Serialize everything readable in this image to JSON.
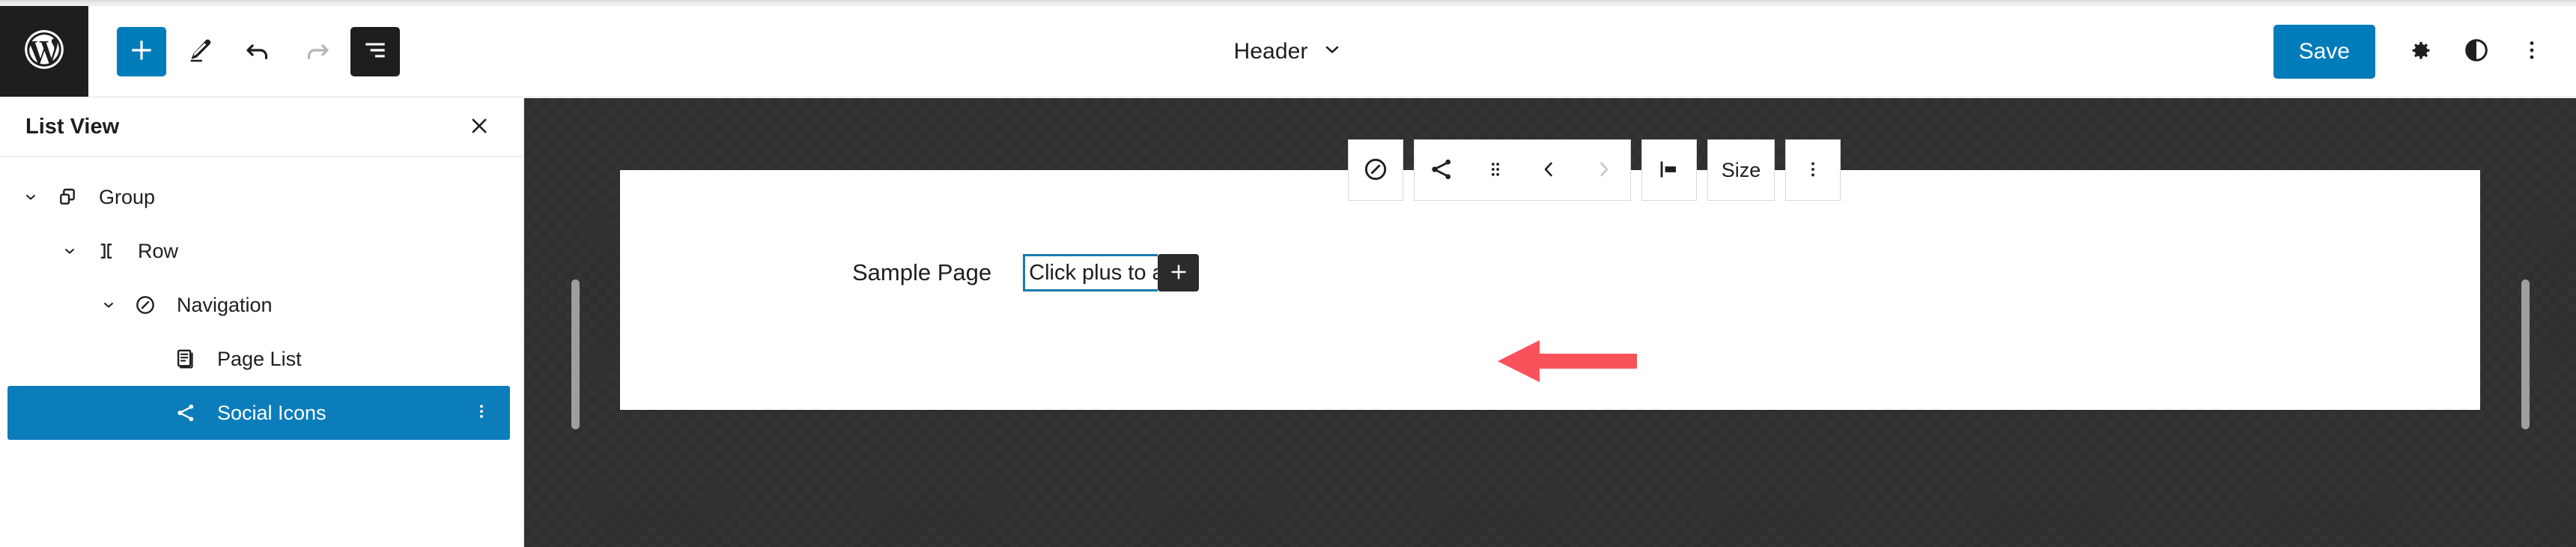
{
  "app": {
    "logo_icon": "wordpress-logo-icon"
  },
  "header": {
    "add_block_label": "+",
    "add_block_icon": "plus-icon",
    "edit_icon": "pencil-edit-icon",
    "undo_icon": "undo-arrow-icon",
    "redo_icon": "redo-arrow-icon",
    "list_view_icon": "list-view-icon",
    "document_title": "Header",
    "document_chevron_icon": "chevron-down-icon",
    "save_label": "Save",
    "settings_icon": "gear-icon",
    "styles_icon": "contrast-half-circle-icon",
    "options_icon": "three-dots-vertical-icon"
  },
  "sidebar": {
    "title": "List View",
    "close_icon": "close-x-icon",
    "items": [
      {
        "label": "Group",
        "icon": "group-blocks-icon",
        "depth": 0,
        "expanded": true,
        "selected": false,
        "has_twisty": true
      },
      {
        "label": "Row",
        "icon": "row-layout-icon",
        "depth": 1,
        "expanded": true,
        "selected": false,
        "has_twisty": true
      },
      {
        "label": "Navigation",
        "icon": "navigation-compass-icon",
        "depth": 2,
        "expanded": true,
        "selected": false,
        "has_twisty": true
      },
      {
        "label": "Page List",
        "icon": "page-list-document-icon",
        "depth": 3,
        "expanded": false,
        "selected": false,
        "has_twisty": false
      },
      {
        "label": "Social Icons",
        "icon": "social-share-icon",
        "depth": 3,
        "expanded": false,
        "selected": true,
        "has_twisty": false,
        "menu_icon": "three-dots-vertical-icon"
      }
    ]
  },
  "block_toolbar": {
    "parent_block_icon": "navigation-compass-icon",
    "block_type_icon": "social-share-icon",
    "drag_handle_icon": "drag-dots-icon",
    "move_prev_icon": "chevron-left-icon",
    "move_next_icon": "chevron-right-icon",
    "align_icon": "align-left-icon",
    "size_label": "Size",
    "options_icon": "three-dots-vertical-icon"
  },
  "canvas": {
    "resize_handle_left_icon": "resize-handle-icon",
    "resize_handle_right_icon": "resize-handle-icon",
    "nav_items": [
      "Sample Page"
    ],
    "link_input_value": "Click plus to a",
    "link_input_placeholder": "Click plus to add",
    "add_link_icon": "plus-icon"
  },
  "annotation": {
    "arrow_icon": "left-pointing-arrow-annotation",
    "color": "#f9525a"
  },
  "colors": {
    "accent_blue": "#007cba",
    "selected_row_blue": "#0b7dba",
    "dark_chrome": "#1e1e1e",
    "canvas_backdrop": "#2f2f2f",
    "annotation_red": "#f9525a",
    "input_border_blue": "#1a7aad"
  }
}
